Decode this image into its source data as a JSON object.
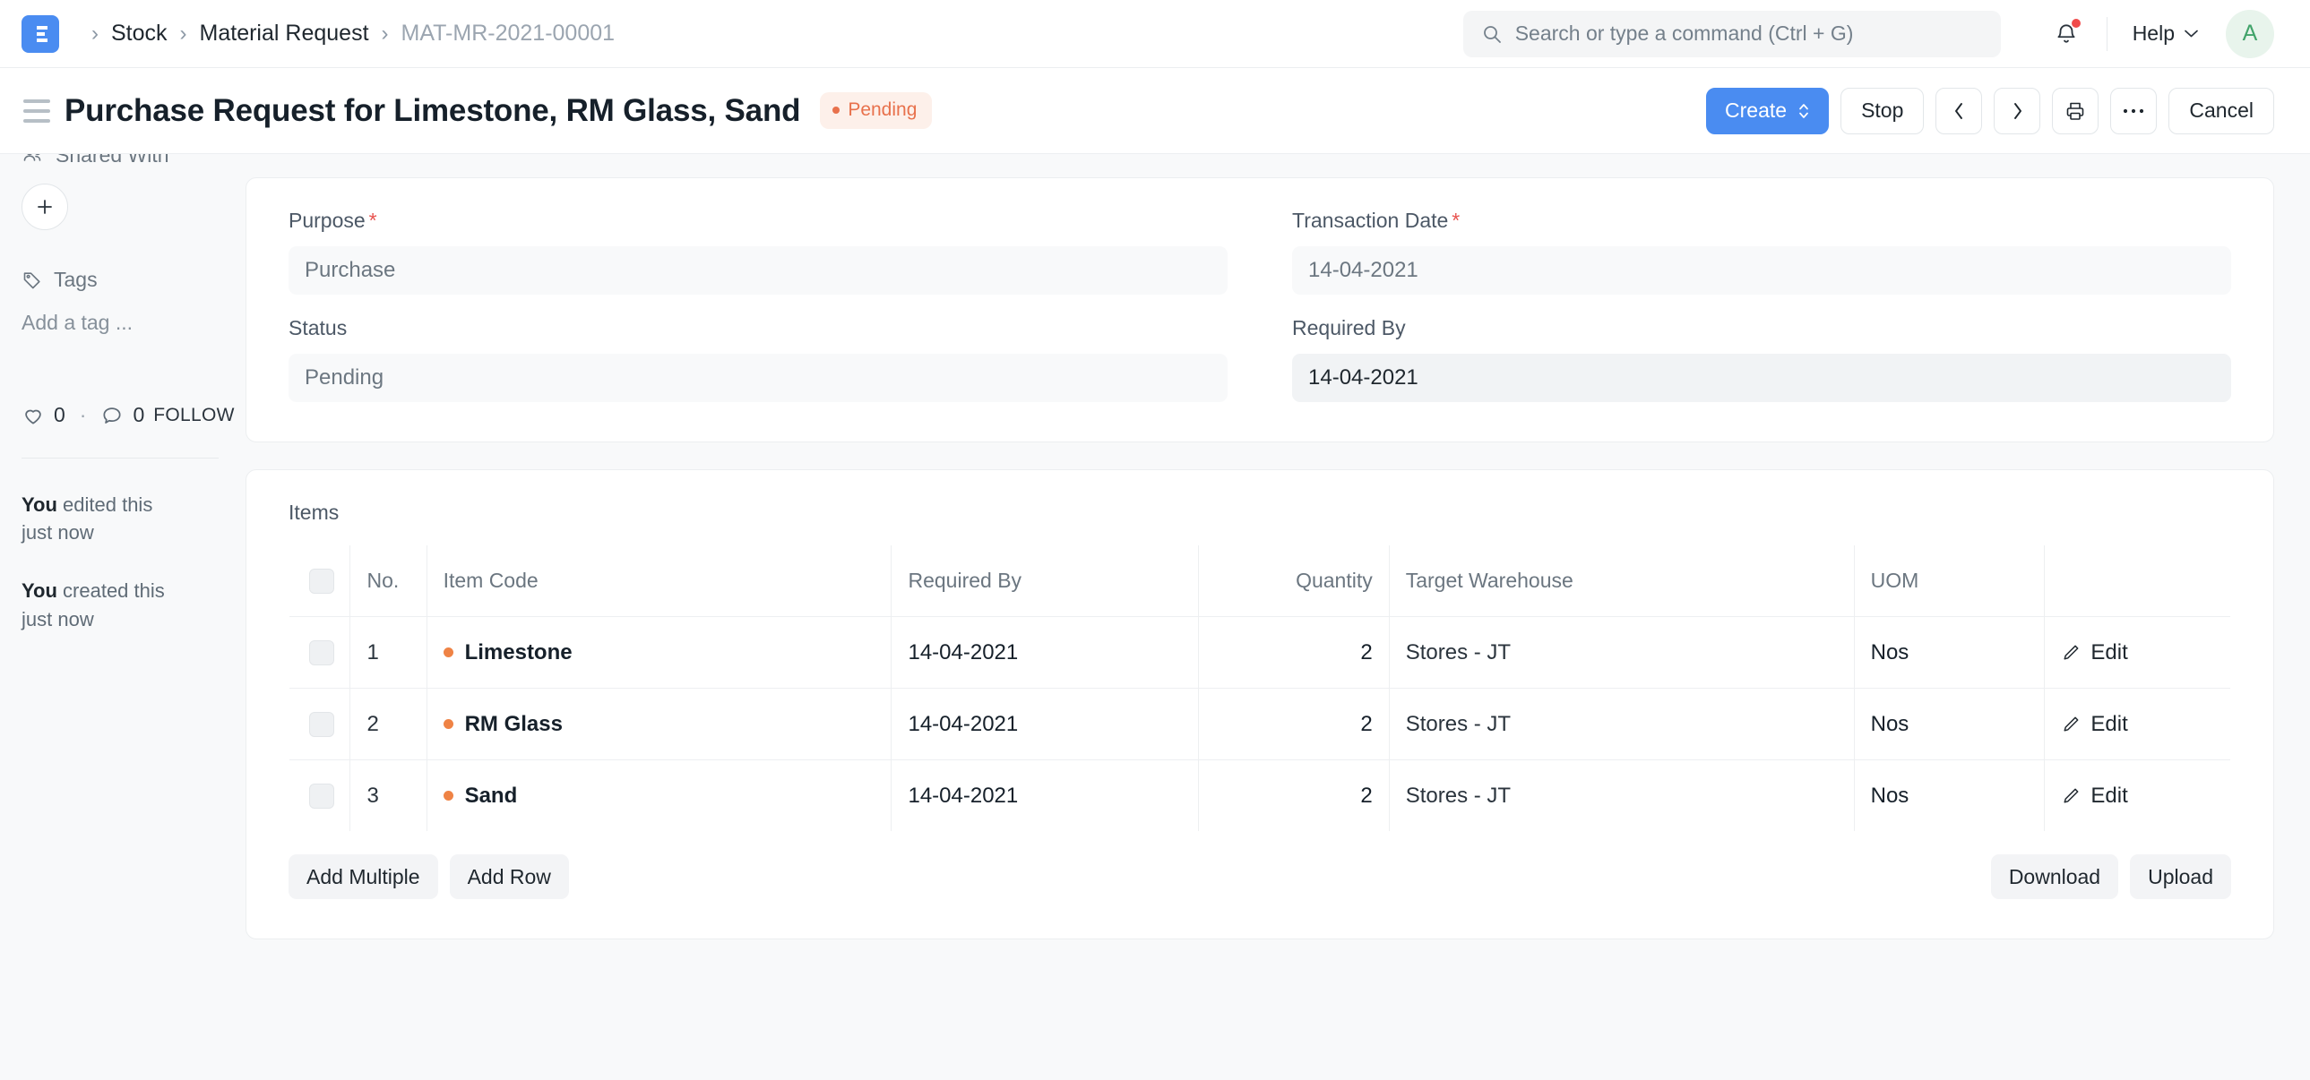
{
  "navbar": {
    "logo_letter": "E",
    "breadcrumbs": [
      {
        "label": "Stock",
        "muted": false
      },
      {
        "label": "Material Request",
        "muted": false
      },
      {
        "label": "MAT-MR-2021-00001",
        "muted": true
      }
    ],
    "separator": "›",
    "search": {
      "placeholder": "Search or type a command (Ctrl + G)",
      "value": ""
    },
    "notifications_icon": "bell-icon",
    "has_notification_badge": true,
    "help_label": "Help",
    "avatar_initial": "A",
    "avatar_color": "#41a36a",
    "avatar_bg": "#e8f4ec"
  },
  "pagehead": {
    "menu_icon": "hamburger-icon",
    "title": "Purchase Request for Limestone, RM Glass, Sand",
    "status": {
      "label": "Pending",
      "color": "#e8714c",
      "bg": "#fdf0ea"
    },
    "actions": {
      "create": "Create",
      "stop": "Stop",
      "prev": "prev-icon",
      "next": "next-icon",
      "print": "print-icon",
      "more": "ellipsis-icon",
      "cancel": "Cancel"
    },
    "primary_color": "#4a8cf1"
  },
  "sidebar": {
    "shared_with_label": "Shared With",
    "add_share_label": "+",
    "tags_label": "Tags",
    "tag_placeholder": "Add a tag ...",
    "likes_count": "0",
    "comments_count": "0",
    "separator_dot": "·",
    "follow_label": "FOLLOW",
    "activity": [
      {
        "who": "You",
        "action": " edited this",
        "time": "just now"
      },
      {
        "who": "You",
        "action": " created this",
        "time": "just now"
      }
    ]
  },
  "form": {
    "fields": [
      {
        "label": "Purpose",
        "required": true,
        "value": "Purchase",
        "editable": false
      },
      {
        "label": "Transaction Date",
        "required": true,
        "value": "14-04-2021",
        "editable": false
      },
      {
        "label": "Status",
        "required": false,
        "value": "Pending",
        "editable": false
      },
      {
        "label": "Required By",
        "required": false,
        "value": "14-04-2021",
        "editable": true
      }
    ]
  },
  "items_section": {
    "label": "Items",
    "columns": [
      "No.",
      "Item Code",
      "Required By",
      "Quantity",
      "Target Warehouse",
      "UOM",
      ""
    ],
    "rows": [
      {
        "no": "1",
        "item_code": "Limestone",
        "required_by": "14-04-2021",
        "quantity": "2",
        "warehouse": "Stores - JT",
        "uom": "Nos",
        "edit": "Edit"
      },
      {
        "no": "2",
        "item_code": "RM Glass",
        "required_by": "14-04-2021",
        "quantity": "2",
        "warehouse": "Stores - JT",
        "uom": "Nos",
        "edit": "Edit"
      },
      {
        "no": "3",
        "item_code": "Sand",
        "required_by": "14-04-2021",
        "quantity": "2",
        "warehouse": "Stores - JT",
        "uom": "Nos",
        "edit": "Edit"
      }
    ],
    "item_dot_color": "#ef8345",
    "footer": {
      "add_multiple": "Add Multiple",
      "add_row": "Add Row",
      "download": "Download",
      "upload": "Upload"
    }
  }
}
